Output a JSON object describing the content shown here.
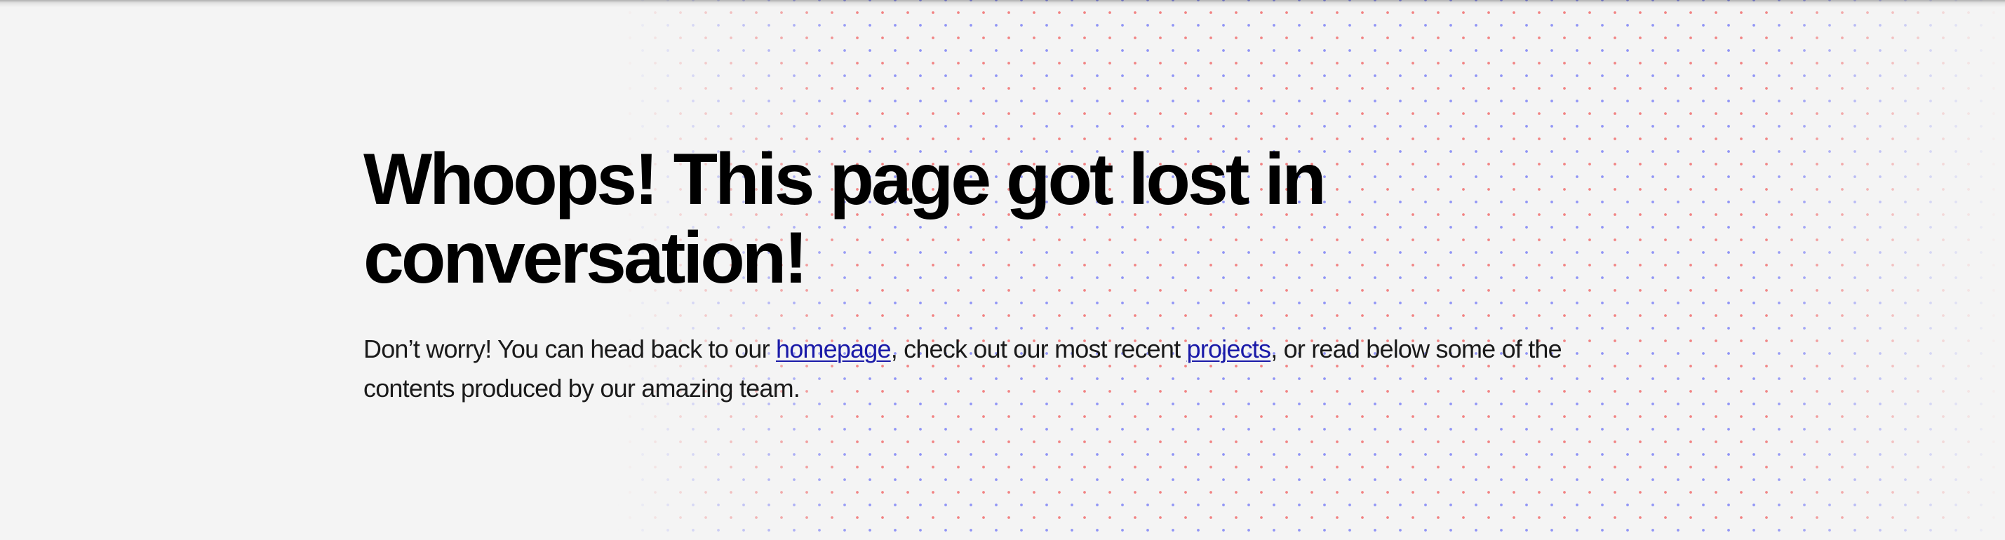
{
  "error": {
    "title": "Whoops! This page got lost in conversation!",
    "message_before_home": "Don’t worry! You can head back to our ",
    "home_link": "homepage",
    "message_between": ", check out our most recent ",
    "projects_link": "projects",
    "message_after": ", or read below some of the contents produced by our amazing team."
  },
  "colors": {
    "background": "#f4f4f4",
    "title": "#000000",
    "body_text": "#1a1a1a",
    "link": "#1a1aa8",
    "dot_red": "#f06e6e",
    "dot_blue": "#7d82f5"
  }
}
